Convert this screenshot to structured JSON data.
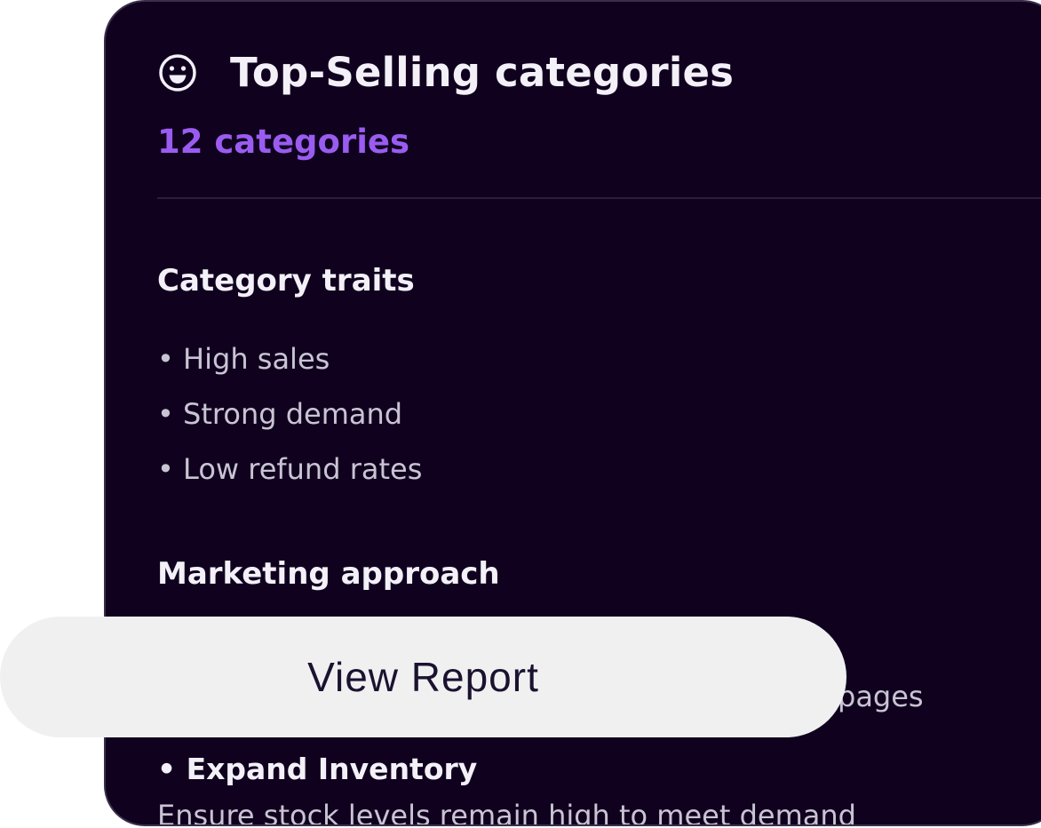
{
  "card": {
    "title": "Top-Selling categories",
    "subtitle": "12 categories",
    "title_icon": "smile-icon",
    "colors": {
      "background": "#10021f",
      "accent": "#9a5cf0",
      "text": "#f3f0f8",
      "muted_text": "#c9c4d3"
    }
  },
  "traits_section": {
    "heading": "Category traits",
    "items": [
      {
        "label": "• High sales"
      },
      {
        "label": "• Strong demand"
      },
      {
        "label": "• Low refund rates"
      }
    ]
  },
  "marketing_section": {
    "heading": "Marketing approach",
    "partial_text": "pages",
    "items": [
      {
        "title": "• Expand Inventory",
        "description": "Ensure stock levels remain high to meet demand"
      }
    ]
  },
  "actions": {
    "view_report_label": "View Report"
  }
}
